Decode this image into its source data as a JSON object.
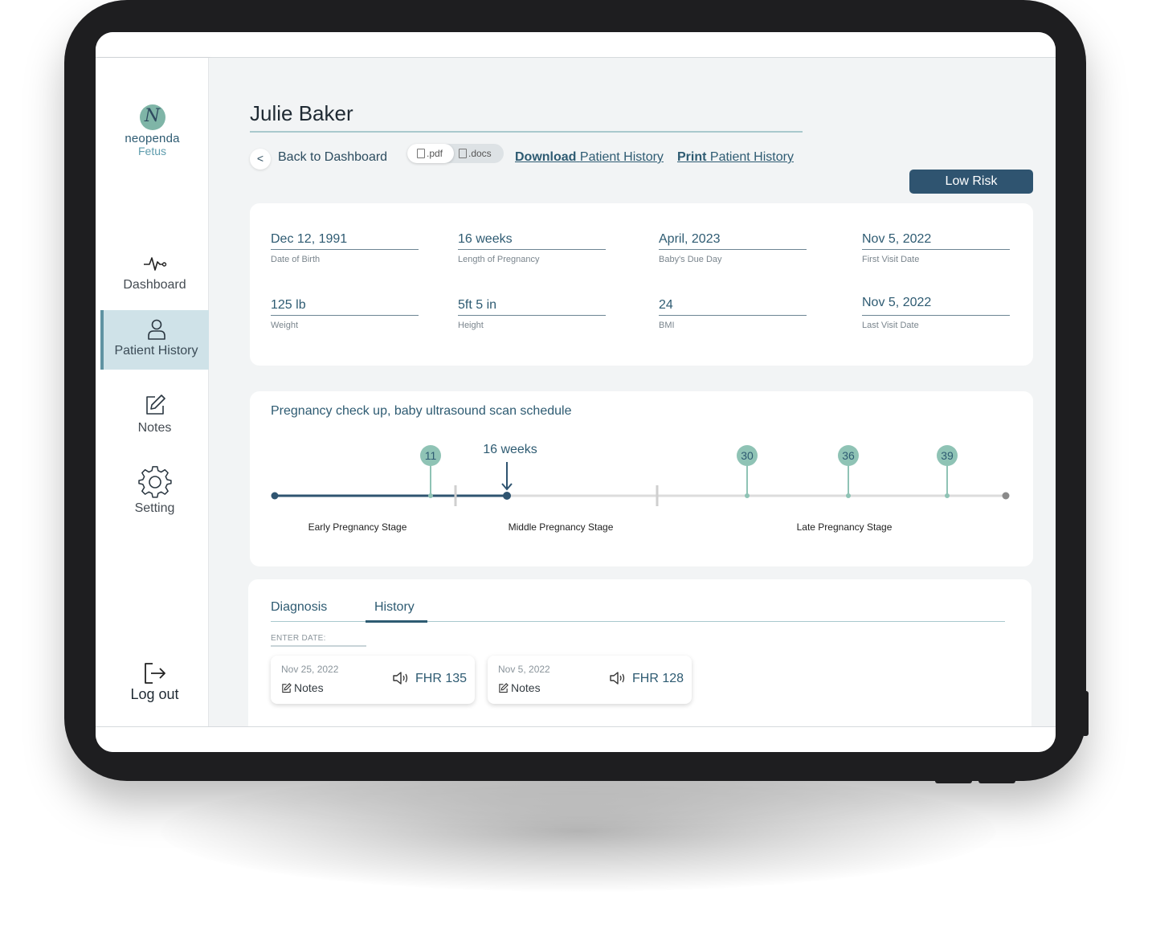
{
  "app": {
    "logo_letter": "N",
    "logo_name": "neopenda",
    "logo_sub": "Fetus"
  },
  "sidebar": {
    "items": [
      {
        "label": "Dashboard",
        "icon": "pulse-icon"
      },
      {
        "label": "Patient History",
        "icon": "user-icon",
        "active": true
      },
      {
        "label": "Notes",
        "icon": "edit-icon"
      },
      {
        "label": "Setting",
        "icon": "gear-icon"
      }
    ],
    "logout": {
      "label": "Log out",
      "icon": "logout-icon"
    }
  },
  "patient": {
    "name": "Julie Baker",
    "risk": "Low Risk"
  },
  "actions": {
    "back_label": "Back to Dashboard",
    "back_icon": "<",
    "format_pdf": ".pdf",
    "format_docs": ".docs",
    "download_bold": "Download",
    "download_rest": "Patient History",
    "print_bold": "Print",
    "print_rest": "Patient History"
  },
  "info_fields": [
    {
      "value": "Dec 12, 1991",
      "label": "Date of Birth"
    },
    {
      "value": "16 weeks",
      "label": "Length of Pregnancy"
    },
    {
      "value": "April, 2023",
      "label": "Baby's Due Day"
    },
    {
      "value": "Nov 5, 2022",
      "label": "First Visit Date"
    },
    {
      "value": "125 lb",
      "label": "Weight"
    },
    {
      "value": "5ft 5 in",
      "label": "Height"
    },
    {
      "value": "24",
      "label": "BMI"
    },
    {
      "value": "Nov 5, 2022",
      "label": "Last Visit Date"
    }
  ],
  "timeline": {
    "title": "Pregnancy check up, baby ultrasound scan schedule",
    "current_label": "16 weeks",
    "current_week": 16,
    "milestones": [
      "11",
      "30",
      "36",
      "39"
    ],
    "stages": [
      "Early Pregnancy Stage",
      "Middle Pregnancy Stage",
      "Late Pregnancy Stage"
    ],
    "colors": {
      "progress": "#2f5470",
      "track": "#dcdcdc",
      "milestone": "#8fc3b5",
      "milestone_text": "#2e5b72"
    }
  },
  "tabs": {
    "items": [
      "Diagnosis",
      "History"
    ],
    "active": "History",
    "enter_date_label": "ENTER DATE:"
  },
  "history": [
    {
      "date": "Nov 25, 2022",
      "notes_label": "Notes",
      "fhr": "FHR 135"
    },
    {
      "date": "Nov 5, 2022",
      "notes_label": "Notes",
      "fhr": "FHR 128"
    }
  ]
}
